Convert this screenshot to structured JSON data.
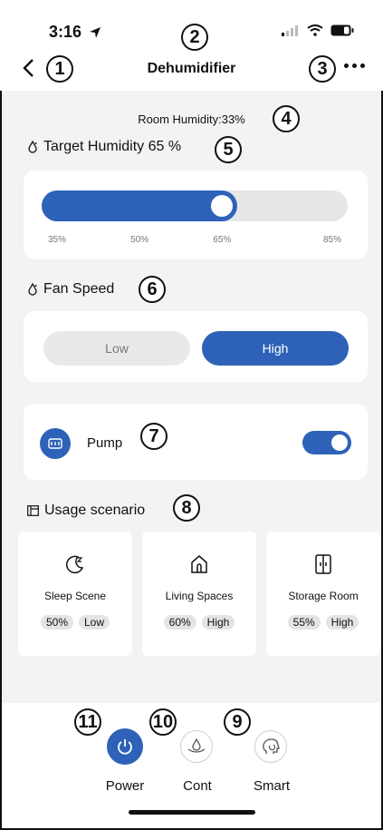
{
  "status": {
    "time": "3:16"
  },
  "header": {
    "title": "Dehumidifier"
  },
  "room_humidity": "Room Humidity:33%",
  "target": {
    "label": "Target Humidity 65 %",
    "value_percent": 65,
    "range": [
      35,
      85
    ],
    "ticks": [
      "35%",
      "50%",
      "65%",
      "85%"
    ]
  },
  "fan": {
    "label": "Fan Speed",
    "options": [
      "Low",
      "High"
    ],
    "selected": "High"
  },
  "pump": {
    "label": "Pump",
    "on": true
  },
  "usage": {
    "label": "Usage scenario",
    "scenes": [
      {
        "name": "Sleep Scene",
        "humidity": "50%",
        "speed": "Low"
      },
      {
        "name": "Living Spaces",
        "humidity": "60%",
        "speed": "High"
      },
      {
        "name": "Storage Room",
        "humidity": "55%",
        "speed": "High"
      }
    ]
  },
  "bottom": {
    "power": "Power",
    "cont": "Cont",
    "smart": "Smart"
  },
  "markers": [
    "1",
    "2",
    "3",
    "4",
    "5",
    "6",
    "7",
    "8",
    "9",
    "10",
    "11"
  ],
  "colors": {
    "accent": "#2d62b8"
  }
}
